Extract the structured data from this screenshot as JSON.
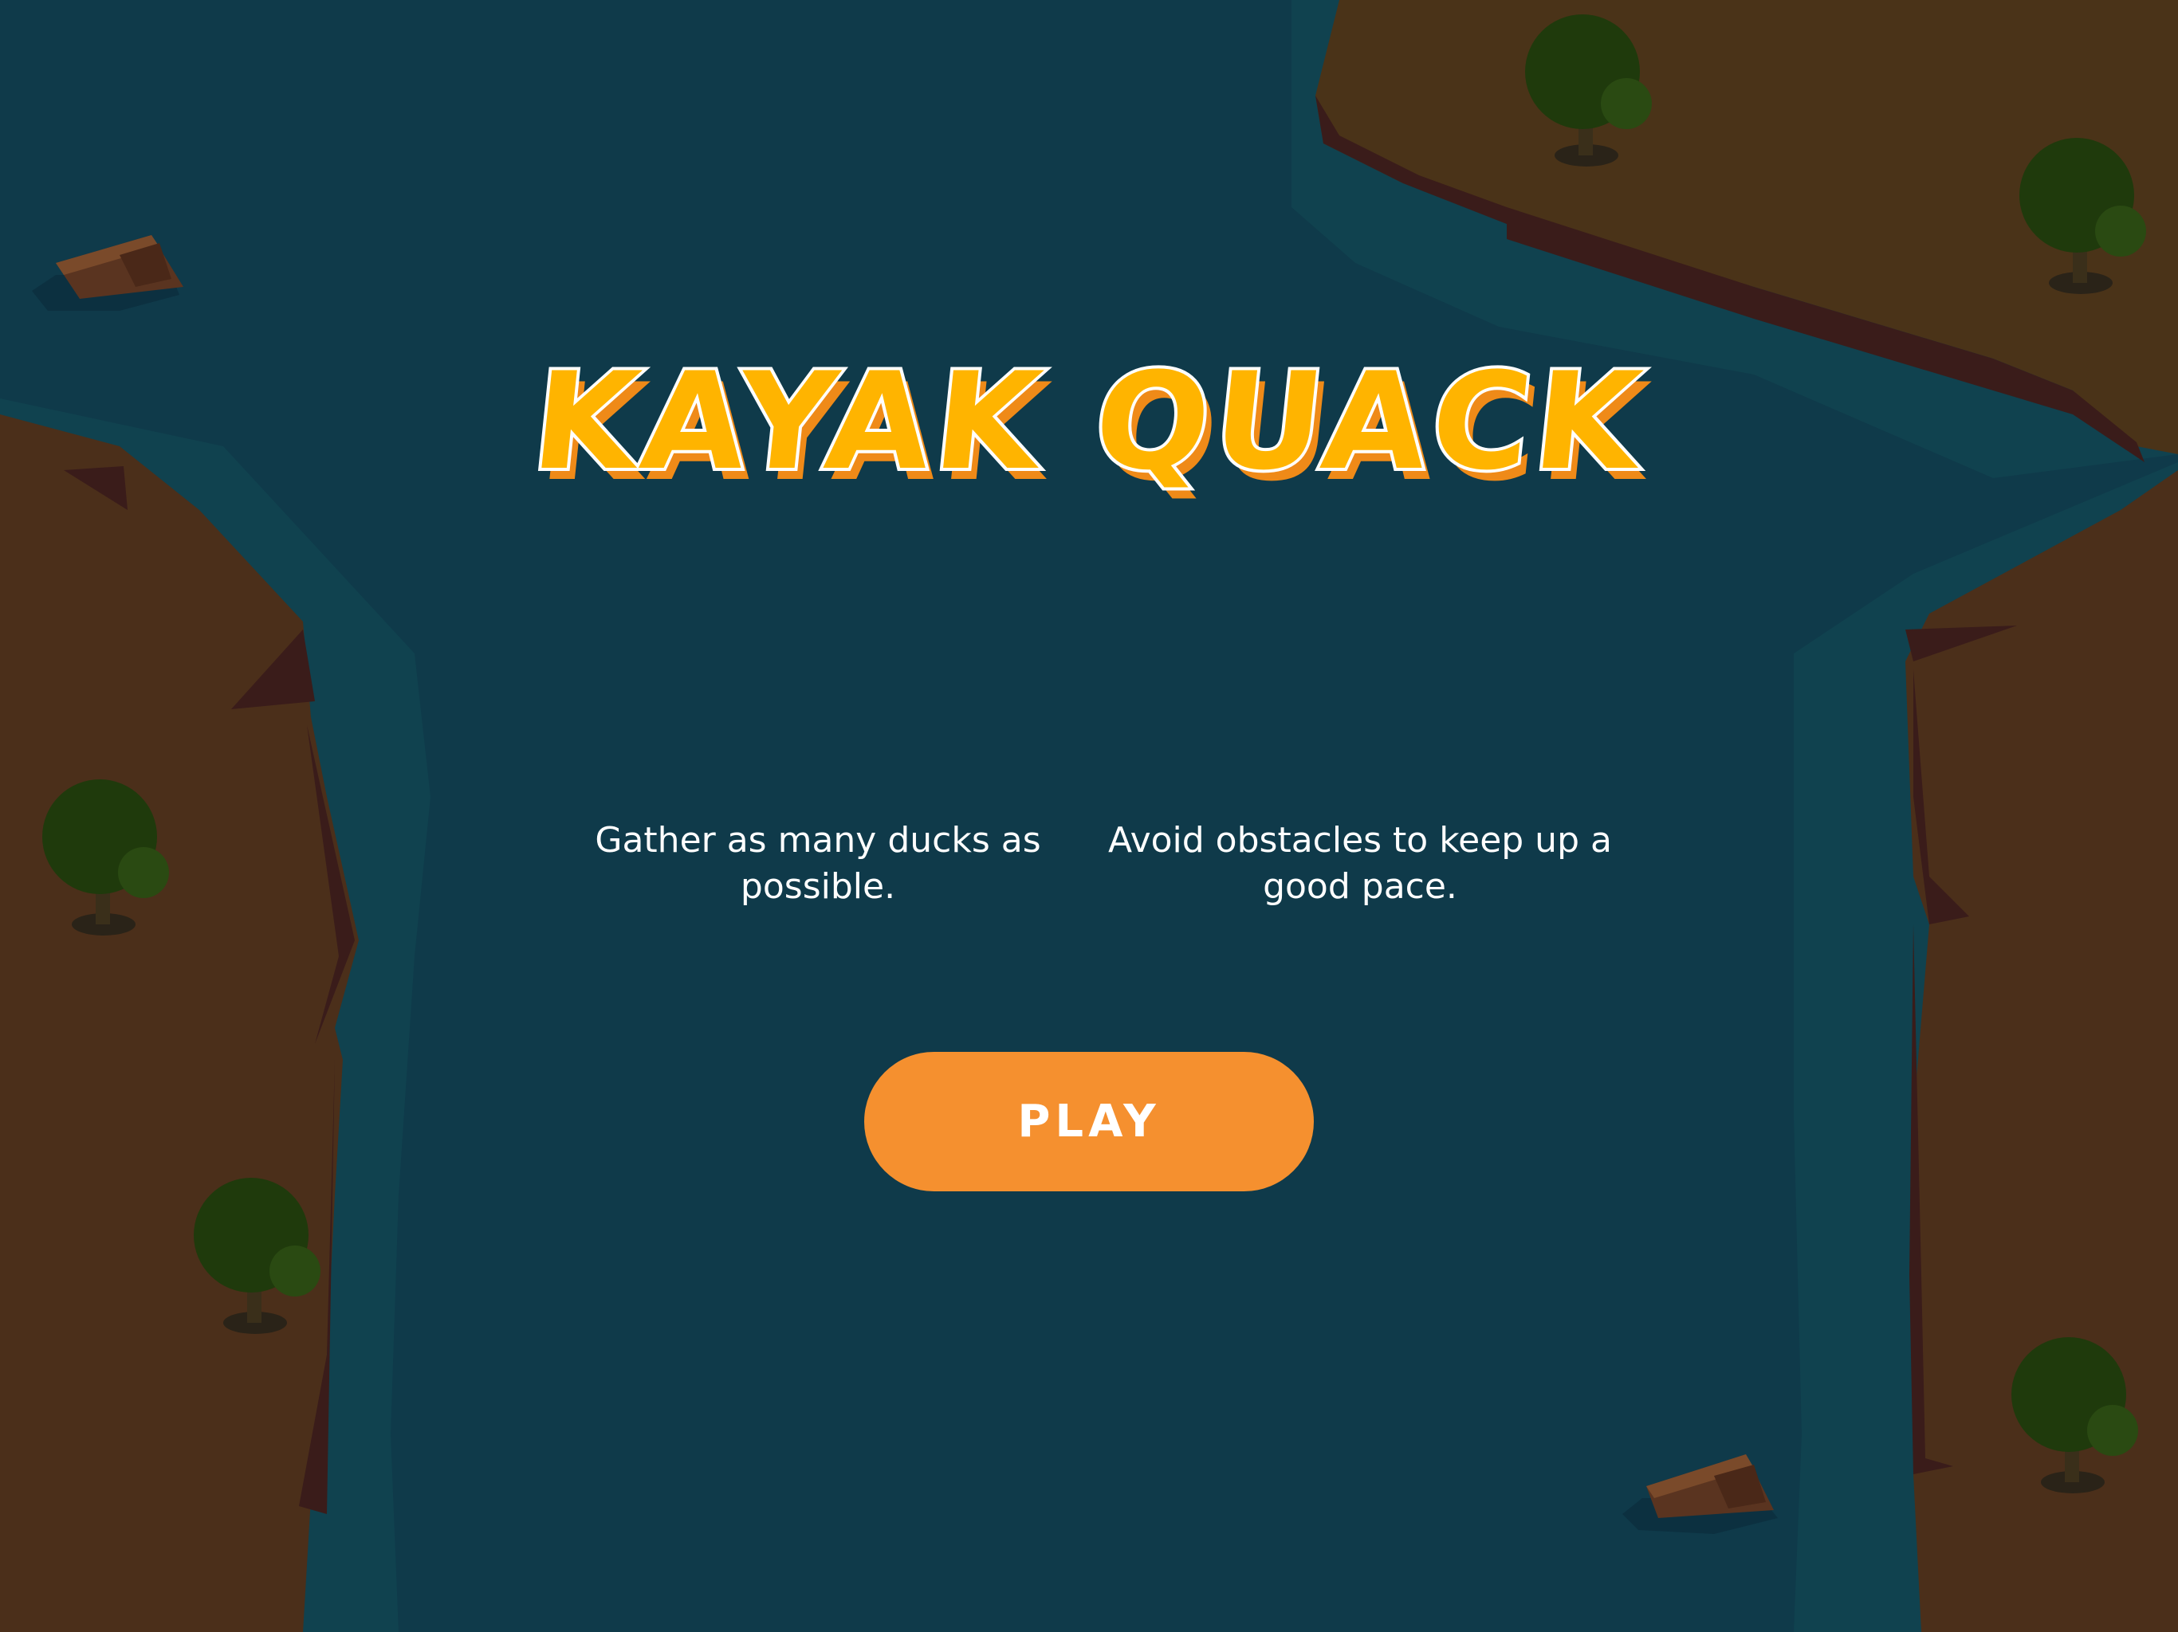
{
  "game": {
    "title": "KAYAK QUACK",
    "instructions": [
      {
        "text": "Gather as many ducks as possible."
      },
      {
        "text": "Avoid obstacles to keep up a good pace."
      }
    ],
    "play_label": "PLAY"
  },
  "colors": {
    "water": "#0f3a4a",
    "shallow_water": "#10424f",
    "bank": "#4b2f1a",
    "cliff_edge": "#3a1c1a",
    "tree": "#1f3a0c",
    "title_fill": "#ffb400",
    "title_shadow": "#ef8a18",
    "play_button": "#f5902f"
  }
}
